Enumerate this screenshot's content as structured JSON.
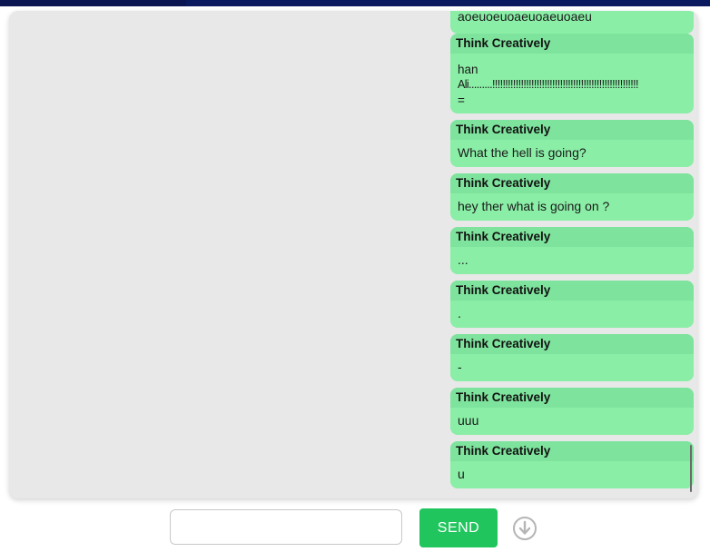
{
  "messages": [
    {
      "author": "Think Creatively",
      "text": "aoeuoeuoaeuoaeuoaeu",
      "partial": true
    },
    {
      "author": "Think Creatively",
      "lines": [
        "han",
        "Ali.........!!!!!!!!!!!!!!!!!!!!!!!!!!!!!!!!!!!!!!!!!!!!!!!!!!!!!!!!",
        "="
      ]
    },
    {
      "author": "Think Creatively",
      "text": "What the hell is going?"
    },
    {
      "author": "Think Creatively",
      "text": "hey ther what is going on ?"
    },
    {
      "author": "Think Creatively",
      "text": "..."
    },
    {
      "author": "Think Creatively",
      "text": "."
    },
    {
      "author": "Think Creatively",
      "text": "-"
    },
    {
      "author": "Think Creatively",
      "text": "uuu"
    },
    {
      "author": "Think Creatively",
      "text": "u"
    }
  ],
  "composer": {
    "input_value": "",
    "input_placeholder": "",
    "send_label": "SEND",
    "scroll_icon": "arrow-down-circle-icon"
  },
  "colors": {
    "bubble": "#8aeea6",
    "bubble_header": "#7ee39d",
    "send_button": "#21c55d",
    "panel": "#e8e8e8",
    "topbar": "#0b1a5e"
  }
}
